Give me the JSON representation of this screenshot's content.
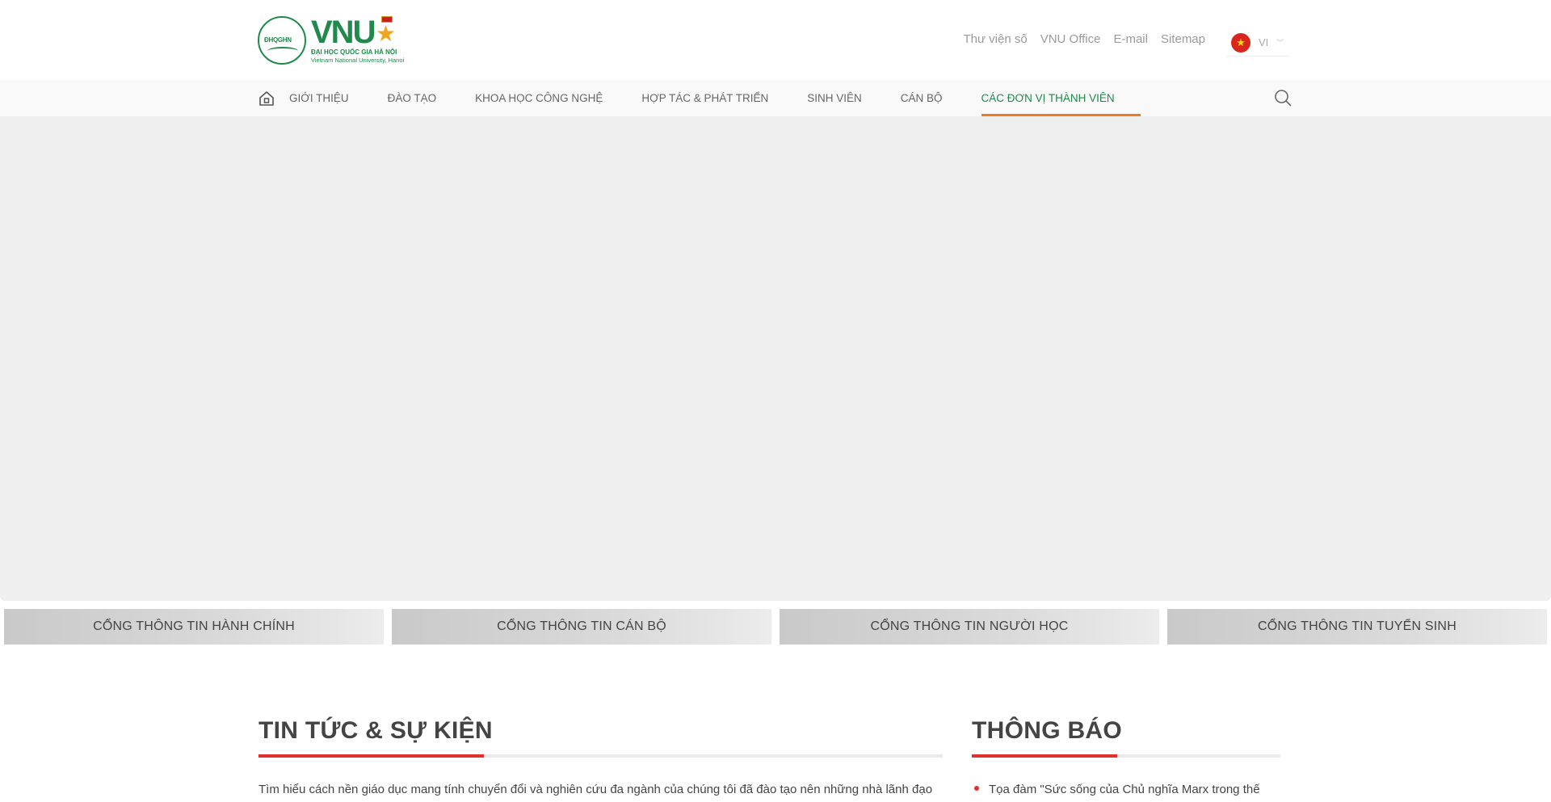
{
  "logo": {
    "brand": "VNU",
    "circle_text": "ĐHQGHN",
    "subtitle_vi": "ĐẠI HỌC QUỐC GIA HÀ NỘI",
    "subtitle_en": "Vietnam National University, Hanoi"
  },
  "toplinks": [
    "Thư viện số",
    "VNU Office",
    "E-mail",
    "Sitemap"
  ],
  "language": {
    "code": "VI"
  },
  "nav": {
    "items": [
      "GIỚI THIỆU",
      "ĐÀO TẠO",
      "KHOA HỌC CÔNG NGHỆ",
      "HỢP TÁC & PHÁT TRIỂN",
      "SINH VIÊN",
      "CÁN BỘ",
      "CÁC ĐƠN VỊ THÀNH VIÊN"
    ],
    "active_index": 6
  },
  "portals": [
    "CỔNG THÔNG TIN HÀNH CHÍNH",
    "CỔNG THÔNG TIN CÁN BỘ",
    "CỔNG THÔNG TIN NGƯỜI HỌC",
    "CỔNG THÔNG TIN TUYỂN SINH"
  ],
  "news": {
    "title": "TIN TỨC & SỰ KIỆN",
    "intro": "Tìm hiểu cách nền giáo dục mang tính chuyển đổi và nghiên cứu đa ngành của chúng tôi đã đào tạo nên những nhà lãnh đạo"
  },
  "notices": {
    "title": "THÔNG BÁO",
    "items": [
      "Tọa đàm \"Sức sống của Chủ nghĩa Marx trong thế"
    ]
  },
  "colors": {
    "brand_green": "#1f8a4c",
    "accent_orange": "#f07c20",
    "accent_red": "#e03030"
  }
}
